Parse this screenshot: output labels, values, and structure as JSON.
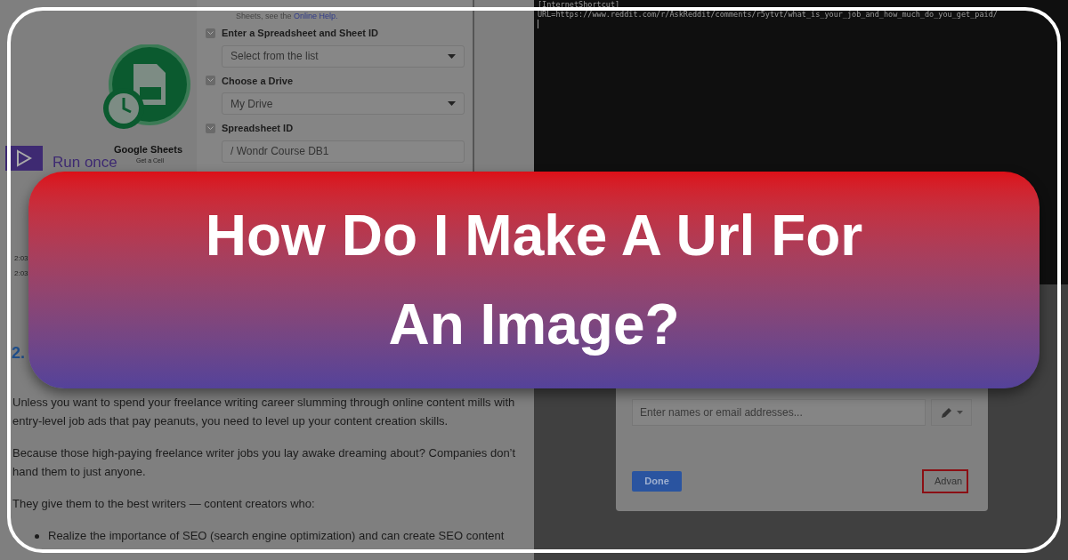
{
  "form_panel": {
    "help_text": "Sheets, see the",
    "help_link": "Online Help.",
    "fields": [
      {
        "label": "Enter a Spreadsheet and Sheet ID",
        "value": "Select from the list",
        "kind": "dropdown",
        "checked": true
      },
      {
        "label": "Choose a Drive",
        "value": "My Drive",
        "kind": "dropdown",
        "checked": true
      },
      {
        "label": "Spreadsheet ID",
        "value": "/ Wondr Course DB1",
        "kind": "text",
        "checked": true
      }
    ]
  },
  "module": {
    "name": "Google Sheets",
    "action": "Get a Cell"
  },
  "run_button": {
    "label": "Run once"
  },
  "log": {
    "times": [
      "2:03",
      "2:03"
    ]
  },
  "article": {
    "heading_number": "2.",
    "paragraphs": [
      "Unless you want to spend your freelance writing career slumming through online content mills with entry-level job ads that pay peanuts, you need to level up your content creation skills.",
      "Because those high-paying freelance writer jobs you lay awake dreaming about? Companies don’t hand them to just anyone.",
      "They give them to the best writers — content creators who:"
    ],
    "bullets": [
      "Realize the importance of SEO (search engine optimization) and can create SEO content"
    ]
  },
  "terminal": {
    "lines": [
      "[InternetShortcut]",
      "URL=https://www.reddit.com/r/AskReddit/comments/r5ytvt/what_is_your_job_and_how_much_do_you_get_paid/"
    ]
  },
  "share_dialog": {
    "input_placeholder": "Enter names or email addresses...",
    "buttons": [
      "Done",
      "Advan"
    ]
  },
  "banner": {
    "title": "How Do I Make A Url For An Image?"
  }
}
